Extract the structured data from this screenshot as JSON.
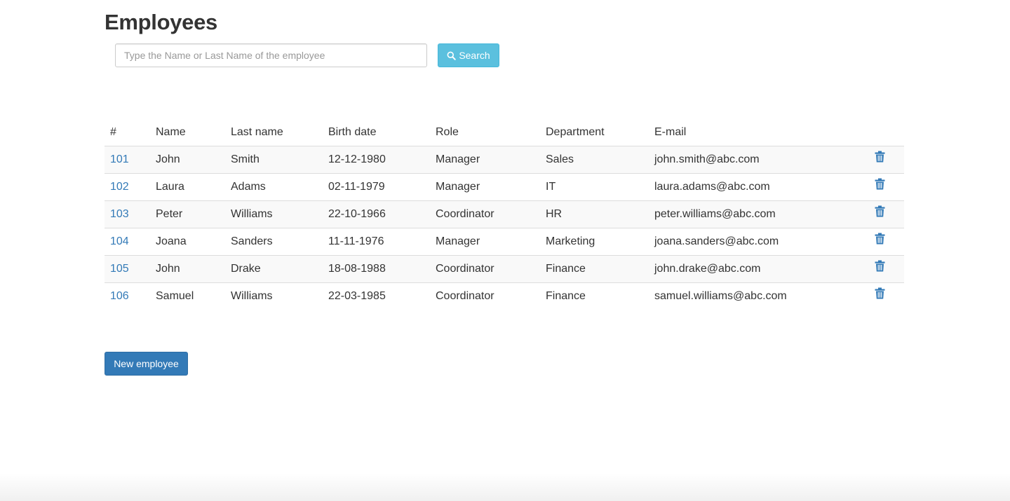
{
  "page": {
    "title": "Employees"
  },
  "search": {
    "placeholder": "Type the Name or Last Name of the employee",
    "value": "",
    "button_label": "Search",
    "button_icon": "search-icon"
  },
  "table": {
    "columns": [
      "#",
      "Name",
      "Last name",
      "Birth date",
      "Role",
      "Department",
      "E-mail",
      ""
    ],
    "rows": [
      {
        "id": "101",
        "name": "John",
        "last_name": "Smith",
        "birth_date": "12-12-1980",
        "role": "Manager",
        "department": "Sales",
        "email": "john.smith@abc.com",
        "action_icon": "trash-icon"
      },
      {
        "id": "102",
        "name": "Laura",
        "last_name": "Adams",
        "birth_date": "02-11-1979",
        "role": "Manager",
        "department": "IT",
        "email": "laura.adams@abc.com",
        "action_icon": "trash-icon"
      },
      {
        "id": "103",
        "name": "Peter",
        "last_name": "Williams",
        "birth_date": "22-10-1966",
        "role": "Coordinator",
        "department": "HR",
        "email": "peter.williams@abc.com",
        "action_icon": "trash-icon"
      },
      {
        "id": "104",
        "name": "Joana",
        "last_name": "Sanders",
        "birth_date": "11-11-1976",
        "role": "Manager",
        "department": "Marketing",
        "email": "joana.sanders@abc.com",
        "action_icon": "trash-icon"
      },
      {
        "id": "105",
        "name": "John",
        "last_name": "Drake",
        "birth_date": "18-08-1988",
        "role": "Coordinator",
        "department": "Finance",
        "email": "john.drake@abc.com",
        "action_icon": "trash-icon"
      },
      {
        "id": "106",
        "name": "Samuel",
        "last_name": "Williams",
        "birth_date": "22-03-1985",
        "role": "Coordinator",
        "department": "Finance",
        "email": "samuel.williams@abc.com",
        "action_icon": "trash-icon"
      }
    ]
  },
  "actions": {
    "new_employee_label": "New employee"
  },
  "colors": {
    "link": "#337ab7",
    "primary_button": "#337ab7",
    "info_button": "#5bc0de",
    "stripe": "#f9f9f9",
    "border": "#dddddd",
    "text": "#333333"
  }
}
